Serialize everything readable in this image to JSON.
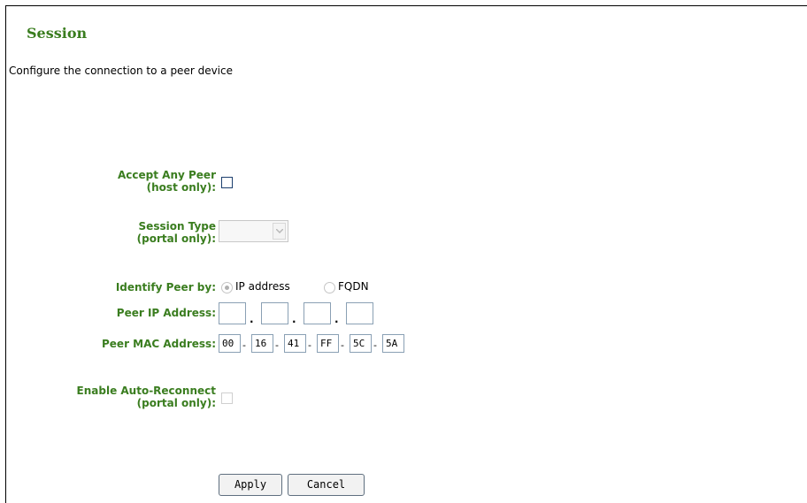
{
  "title": "Session",
  "description": "Configure the connection to a peer device",
  "accept_any_peer": {
    "label_line1": "Accept Any Peer",
    "label_line2": "(host only):"
  },
  "session_type": {
    "label_line1": "Session Type",
    "label_line2": "(portal only):",
    "selected": ""
  },
  "identify_peer": {
    "label": "Identify Peer by:",
    "option_ip": "IP address",
    "option_fqdn": "FQDN",
    "selected": "IP address"
  },
  "peer_ip": {
    "label": "Peer IP Address:",
    "octets": [
      "",
      "",
      "",
      ""
    ],
    "separator": "."
  },
  "peer_mac": {
    "label": "Peer MAC Address:",
    "octets": [
      "00",
      "16",
      "41",
      "FF",
      "5C",
      "5A"
    ],
    "separator": "-"
  },
  "auto_reconnect": {
    "label_line1": "Enable Auto-Reconnect",
    "label_line2": "(portal only):"
  },
  "buttons": {
    "apply": "Apply",
    "cancel": "Cancel"
  }
}
